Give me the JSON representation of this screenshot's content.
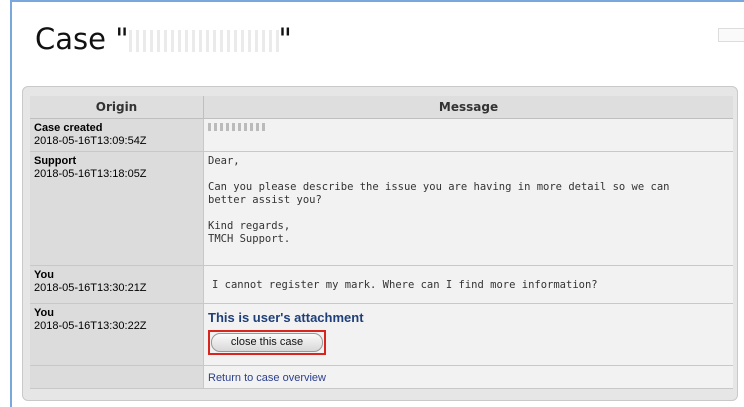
{
  "page": {
    "title_prefix": "Case \"",
    "title_suffix": "\""
  },
  "table": {
    "headers": {
      "origin": "Origin",
      "message": "Message"
    },
    "rows": [
      {
        "origin": "Case created",
        "date": "2018-05-16T13:09:54Z",
        "message": []
      },
      {
        "origin": "Support",
        "date": "2018-05-16T13:18:05Z",
        "message": [
          "Dear,",
          "Can you please describe the issue you are having in more detail so we can",
          "better assist you?",
          "Kind regards,",
          "TMCH Support."
        ]
      },
      {
        "origin": "You",
        "date": "2018-05-16T13:30:21Z",
        "message": [
          "I cannot register my mark. Where can I find more information?"
        ]
      },
      {
        "origin": "You",
        "date": "2018-05-16T13:30:22Z",
        "attachment_label": "This is user's attachment",
        "button_label": "close this case"
      }
    ],
    "footer_link": "Return to case overview"
  },
  "colors": {
    "highlight": "#d8261e",
    "link": "#2b3f8f",
    "attachment": "#1f3f78",
    "frame": "#7aa8dd"
  }
}
